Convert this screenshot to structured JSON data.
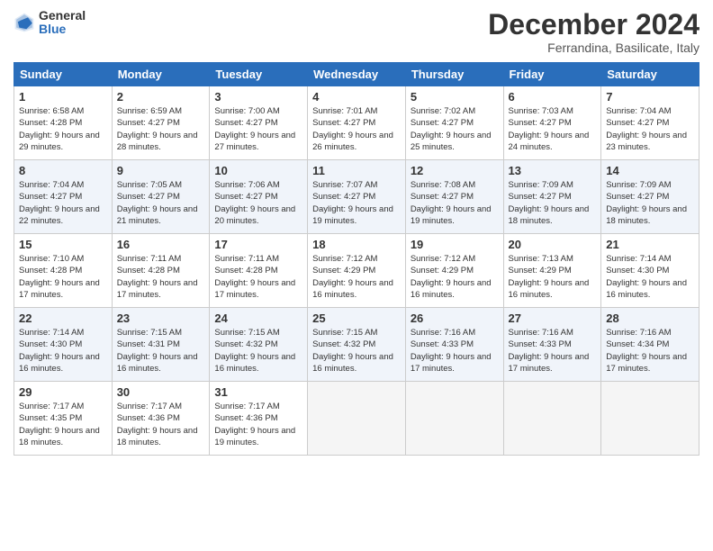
{
  "header": {
    "logo_general": "General",
    "logo_blue": "Blue",
    "month_title": "December 2024",
    "subtitle": "Ferrandina, Basilicate, Italy"
  },
  "weekdays": [
    "Sunday",
    "Monday",
    "Tuesday",
    "Wednesday",
    "Thursday",
    "Friday",
    "Saturday"
  ],
  "weeks": [
    [
      {
        "day": 1,
        "sunrise": "6:58 AM",
        "sunset": "4:28 PM",
        "daylight": "9 hours and 29 minutes."
      },
      {
        "day": 2,
        "sunrise": "6:59 AM",
        "sunset": "4:27 PM",
        "daylight": "9 hours and 28 minutes."
      },
      {
        "day": 3,
        "sunrise": "7:00 AM",
        "sunset": "4:27 PM",
        "daylight": "9 hours and 27 minutes."
      },
      {
        "day": 4,
        "sunrise": "7:01 AM",
        "sunset": "4:27 PM",
        "daylight": "9 hours and 26 minutes."
      },
      {
        "day": 5,
        "sunrise": "7:02 AM",
        "sunset": "4:27 PM",
        "daylight": "9 hours and 25 minutes."
      },
      {
        "day": 6,
        "sunrise": "7:03 AM",
        "sunset": "4:27 PM",
        "daylight": "9 hours and 24 minutes."
      },
      {
        "day": 7,
        "sunrise": "7:04 AM",
        "sunset": "4:27 PM",
        "daylight": "9 hours and 23 minutes."
      }
    ],
    [
      {
        "day": 8,
        "sunrise": "7:04 AM",
        "sunset": "4:27 PM",
        "daylight": "9 hours and 22 minutes."
      },
      {
        "day": 9,
        "sunrise": "7:05 AM",
        "sunset": "4:27 PM",
        "daylight": "9 hours and 21 minutes."
      },
      {
        "day": 10,
        "sunrise": "7:06 AM",
        "sunset": "4:27 PM",
        "daylight": "9 hours and 20 minutes."
      },
      {
        "day": 11,
        "sunrise": "7:07 AM",
        "sunset": "4:27 PM",
        "daylight": "9 hours and 19 minutes."
      },
      {
        "day": 12,
        "sunrise": "7:08 AM",
        "sunset": "4:27 PM",
        "daylight": "9 hours and 19 minutes."
      },
      {
        "day": 13,
        "sunrise": "7:09 AM",
        "sunset": "4:27 PM",
        "daylight": "9 hours and 18 minutes."
      },
      {
        "day": 14,
        "sunrise": "7:09 AM",
        "sunset": "4:27 PM",
        "daylight": "9 hours and 18 minutes."
      }
    ],
    [
      {
        "day": 15,
        "sunrise": "7:10 AM",
        "sunset": "4:28 PM",
        "daylight": "9 hours and 17 minutes."
      },
      {
        "day": 16,
        "sunrise": "7:11 AM",
        "sunset": "4:28 PM",
        "daylight": "9 hours and 17 minutes."
      },
      {
        "day": 17,
        "sunrise": "7:11 AM",
        "sunset": "4:28 PM",
        "daylight": "9 hours and 17 minutes."
      },
      {
        "day": 18,
        "sunrise": "7:12 AM",
        "sunset": "4:29 PM",
        "daylight": "9 hours and 16 minutes."
      },
      {
        "day": 19,
        "sunrise": "7:12 AM",
        "sunset": "4:29 PM",
        "daylight": "9 hours and 16 minutes."
      },
      {
        "day": 20,
        "sunrise": "7:13 AM",
        "sunset": "4:29 PM",
        "daylight": "9 hours and 16 minutes."
      },
      {
        "day": 21,
        "sunrise": "7:14 AM",
        "sunset": "4:30 PM",
        "daylight": "9 hours and 16 minutes."
      }
    ],
    [
      {
        "day": 22,
        "sunrise": "7:14 AM",
        "sunset": "4:30 PM",
        "daylight": "9 hours and 16 minutes."
      },
      {
        "day": 23,
        "sunrise": "7:15 AM",
        "sunset": "4:31 PM",
        "daylight": "9 hours and 16 minutes."
      },
      {
        "day": 24,
        "sunrise": "7:15 AM",
        "sunset": "4:32 PM",
        "daylight": "9 hours and 16 minutes."
      },
      {
        "day": 25,
        "sunrise": "7:15 AM",
        "sunset": "4:32 PM",
        "daylight": "9 hours and 16 minutes."
      },
      {
        "day": 26,
        "sunrise": "7:16 AM",
        "sunset": "4:33 PM",
        "daylight": "9 hours and 17 minutes."
      },
      {
        "day": 27,
        "sunrise": "7:16 AM",
        "sunset": "4:33 PM",
        "daylight": "9 hours and 17 minutes."
      },
      {
        "day": 28,
        "sunrise": "7:16 AM",
        "sunset": "4:34 PM",
        "daylight": "9 hours and 17 minutes."
      }
    ],
    [
      {
        "day": 29,
        "sunrise": "7:17 AM",
        "sunset": "4:35 PM",
        "daylight": "9 hours and 18 minutes."
      },
      {
        "day": 30,
        "sunrise": "7:17 AM",
        "sunset": "4:36 PM",
        "daylight": "9 hours and 18 minutes."
      },
      {
        "day": 31,
        "sunrise": "7:17 AM",
        "sunset": "4:36 PM",
        "daylight": "9 hours and 19 minutes."
      },
      null,
      null,
      null,
      null
    ]
  ]
}
